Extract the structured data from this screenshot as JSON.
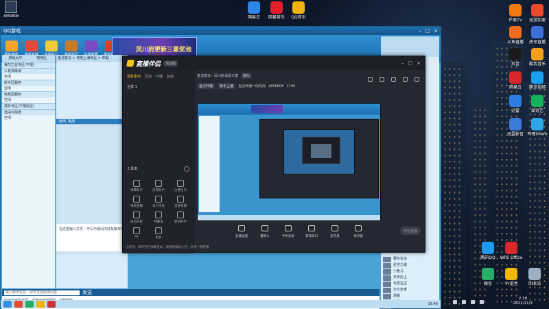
{
  "desktop": {
    "top_left_id": "4856808",
    "top_icons": [
      {
        "label": "网易云",
        "color": "#2b86e8"
      },
      {
        "label": "网易音乐",
        "color": "#e2202b"
      },
      {
        "label": "QQ音乐",
        "color": "#f2b20c"
      }
    ],
    "right_icons": [
      {
        "label": "芒果TV",
        "color": "#f07a10"
      },
      {
        "label": "迅游加速",
        "color": "#e84a2b"
      },
      {
        "label": "斗鱼直播",
        "color": "#f26a1d"
      },
      {
        "label": "虎牙直播",
        "color": "#3a70d8"
      },
      {
        "label": "抖音",
        "color": "#1a1a1a"
      },
      {
        "label": "酷我音乐",
        "color": "#f2a019"
      },
      {
        "label": "网易云",
        "color": "#d8262d"
      },
      {
        "label": "腾讯视频",
        "color": "#1aa1f0"
      },
      {
        "label": "迅雷",
        "color": "#2e7de0"
      },
      {
        "label": "爱奇艺",
        "color": "#13b35c"
      },
      {
        "label": "迅雷影音",
        "color": "#3b7bd9"
      },
      {
        "label": "哔哩Down",
        "color": "#2fa5e5"
      }
    ],
    "bottom_right_icons": [
      {
        "label": "腾讯QQ",
        "color": "#1d9bf0"
      },
      {
        "label": "WPS Office",
        "color": "#d82a2a"
      },
      {
        "label": "微信",
        "color": "#2aae67"
      },
      {
        "label": "YY语音",
        "color": "#f0b500"
      },
      {
        "label": "回收站",
        "color": "#9fb0c4"
      }
    ]
  },
  "game_window": {
    "title": "QQ游戏",
    "toolbar": [
      "我的游戏",
      "游戏商城",
      "充值中心",
      "游戏道具",
      "在线客服",
      "我的日历"
    ],
    "banner": "凤川府更新三星奖池",
    "left_tabs": [
      "游戏大厅",
      "电竞区",
      "我的房间",
      "其他"
    ],
    "tree": [
      {
        "text": "赛尔之星专区(不限)",
        "head": true
      },
      {
        "text": "人机训练场",
        "head": true
      },
      {
        "text": "空闲",
        "head": false
      },
      {
        "text": "新手区服务",
        "head": true
      },
      {
        "text": "空闲",
        "head": false
      },
      {
        "text": "电竞区服务",
        "head": true
      },
      {
        "text": "空闲",
        "head": false
      },
      {
        "text": "高阶专区(不限段位)",
        "head": true
      },
      {
        "text": "自由对战场",
        "head": true
      },
      {
        "text": "空闲",
        "head": false
      }
    ],
    "mid_header": "金戈铁马 > 电竞上海专区 > 匹配",
    "mid_tabs": [
      "房间",
      "观战"
    ],
    "chat_placeholder": "在这里输入文字，可以与房间内好友聊天哦",
    "chat_log": "欢迎来到本房间，请遵守游戏规则，文明游戏。",
    "chat_input_label": "输入聊天信息，即可发送给房间里",
    "chat_send": "发送",
    "status_time": "16:46",
    "friends": [
      "赛尔宝宝",
      "星空之歌",
      "小鱼儿",
      "天天向上",
      "可爱宝宝",
      "大众玩家",
      "游客",
      "流星",
      "萌新一号"
    ]
  },
  "live_app": {
    "name": "直播伴侣",
    "version": "测试版",
    "sidebar_tabs": [
      "场景素材",
      "互动",
      "开播",
      "其他"
    ],
    "scene": "全屏 1",
    "tools_title": "工具箱",
    "tools": [
      "弹幕助手",
      "房管助手",
      "主播任务",
      "视频直播",
      "多人连麦",
      "音频直播",
      "虚拟形象",
      "弹幕墙",
      "歌词助手",
      "PK",
      "更多"
    ],
    "room": {
      "name": "金戈铁马：凤川府请看三楼",
      "tag": "娱乐",
      "badge1": "首次开播",
      "badge2": "新手主播",
      "stats": "当前开播一段时间",
      "room_id": "4856808",
      "followers": "1799"
    },
    "controls": [
      "直播画面",
      "摄像头",
      "手机投屏",
      "游戏窗口",
      "麦克风",
      "扬声器"
    ],
    "start_btn": "开始直播",
    "bottom_note": "小提示：如何开启弹幕互动，请查看帮助文档，享受一键开播"
  },
  "taskbar": {
    "time": "2:18",
    "date": "2022/11/3"
  }
}
